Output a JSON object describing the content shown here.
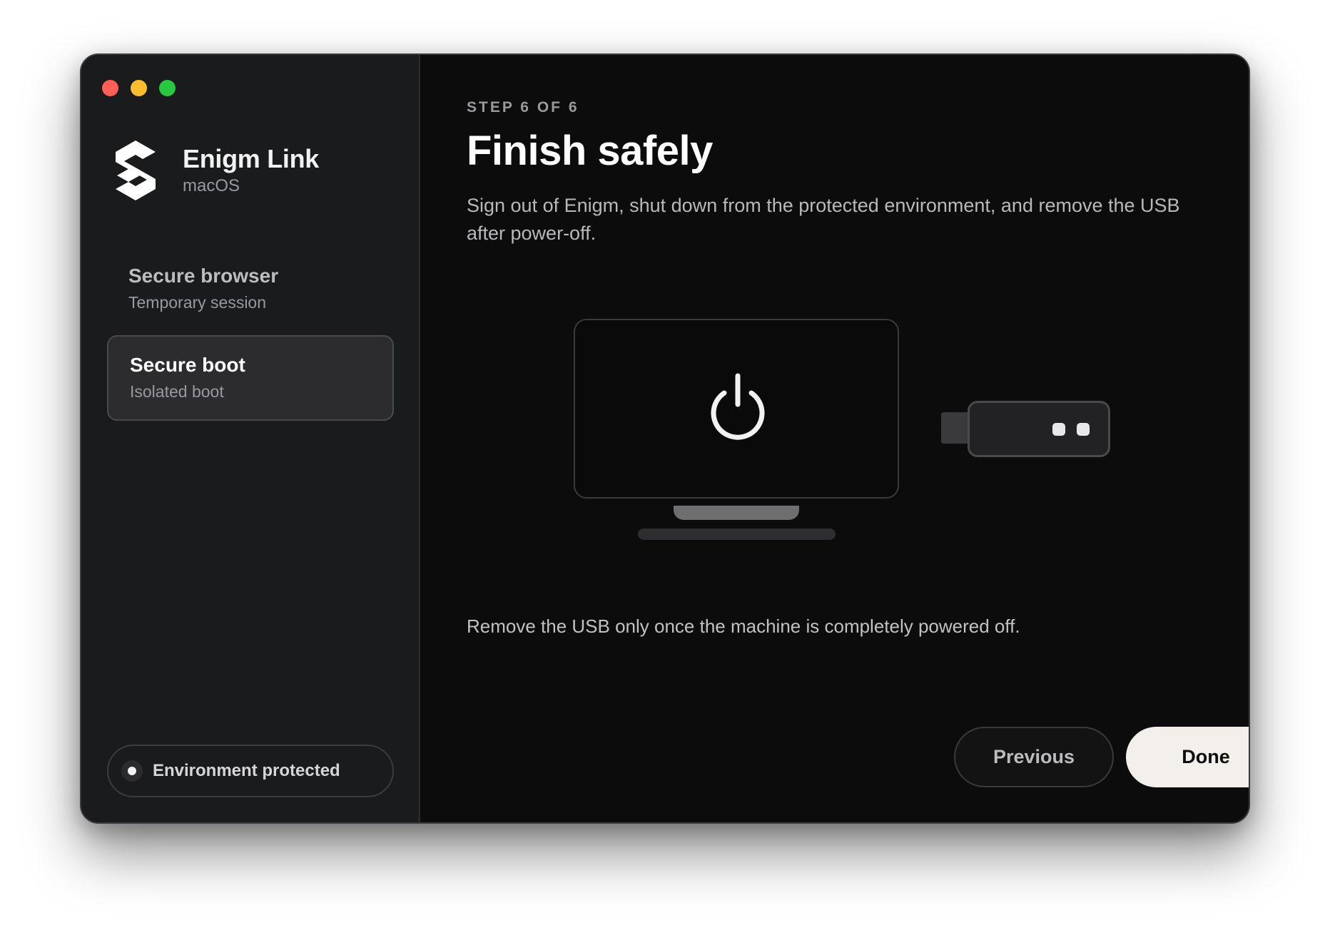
{
  "app": {
    "name": "Enigm Link",
    "platform": "macOS"
  },
  "sidebar": {
    "items": [
      {
        "label": "Secure browser",
        "sublabel": "Temporary session",
        "selected": false
      },
      {
        "label": "Secure boot",
        "sublabel": "Isolated boot",
        "selected": true
      }
    ],
    "status": {
      "label": "Environment protected"
    }
  },
  "main": {
    "step_label": "STEP 6 OF 6",
    "title": "Finish safely",
    "description": "Sign out of Enigm, shut down from the protected environment, and remove the USB after power-off.",
    "note": "Remove the USB only once the machine is completely powered off.",
    "illustration": {
      "icons": [
        "monitor-icon",
        "power-icon",
        "usb-drive-icon"
      ]
    }
  },
  "footer": {
    "previous_label": "Previous",
    "done_label": "Done"
  },
  "colors": {
    "window_bg": "#0c0c0d",
    "sidebar_bg": "#1a1b1d",
    "selected_item_bg": "#2c2c2e",
    "done_button_bg": "#f3f0eb",
    "traffic_red": "#ff5f57",
    "traffic_yellow": "#febc2e",
    "traffic_green": "#28c840"
  }
}
